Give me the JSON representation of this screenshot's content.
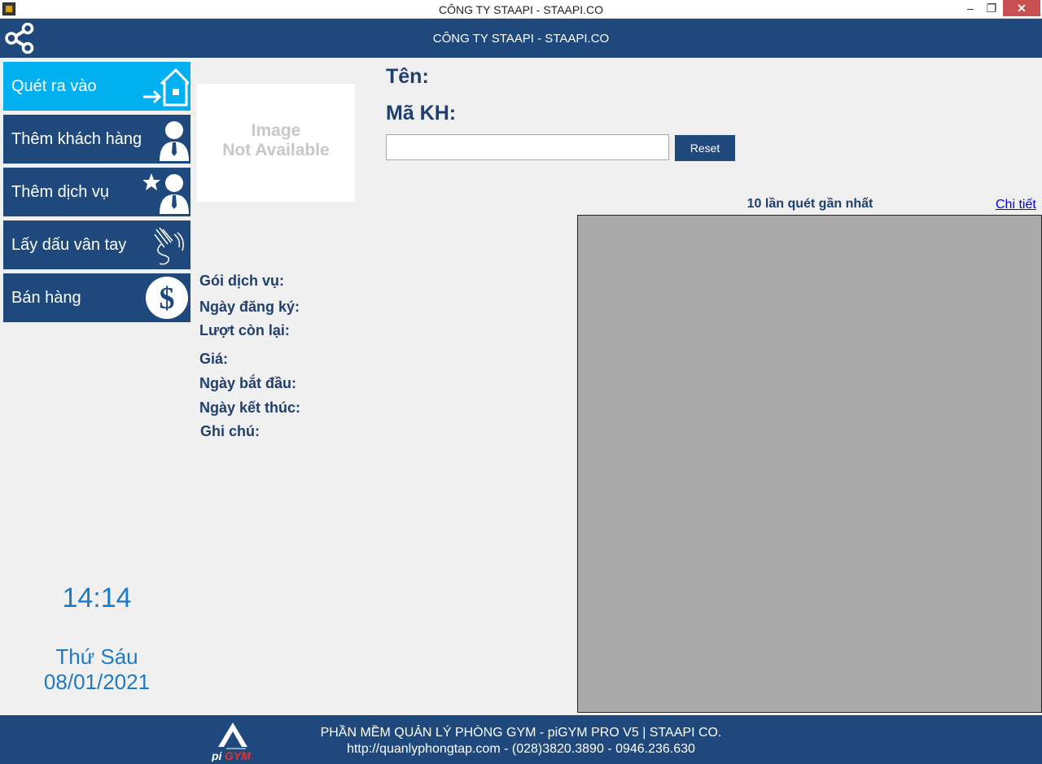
{
  "window": {
    "title": "CÔNG TY STAAPI - STAAPI.CO",
    "min": "–",
    "max": "❐",
    "close": "✕"
  },
  "header": {
    "title": "CÔNG TY STAAPI - STAAPI.CO"
  },
  "menu": [
    {
      "label": "Quét ra vào",
      "icon": "house-enter-icon"
    },
    {
      "label": "Thêm khách hàng",
      "icon": "user-icon"
    },
    {
      "label": "Thêm dịch vụ",
      "icon": "star-user-icon"
    },
    {
      "label": "Lấy dấu vân tay",
      "icon": "fingerprint-hand-icon"
    },
    {
      "label": "Bán hàng",
      "icon": "dollar-icon"
    }
  ],
  "photo": {
    "line1": "Image",
    "line2": "Not Available"
  },
  "customer": {
    "name_label": "Tên:",
    "code_label": "Mã KH:",
    "input_value": "",
    "reset_label": "Reset"
  },
  "info": {
    "package": "Gói dịch vụ:",
    "registered": "Ngày đăng ký:",
    "remaining": "Lượt còn lại:",
    "price": "Giá:",
    "start": "Ngày bắt đầu:",
    "end": "Ngày kết thúc:",
    "note": "Ghi chú:"
  },
  "clock": {
    "time": "14:14",
    "weekday": "Thứ Sáu",
    "date": "08/01/2021"
  },
  "recent": {
    "title": "10 lần quét gần nhất",
    "link": "Chi tiết"
  },
  "footer": {
    "line1": "PHẦN MỀM QUẢN LÝ PHÒNG GYM - piGYM PRO V5 | STAAPI CO.",
    "line2": "http://quanlyphongtap.com - (028)3820.3890 - 0946.236.630",
    "logo_text_pi": "pi",
    "logo_text_gym": "GYM"
  },
  "colors": {
    "primary": "#1f497d",
    "active": "#00b0f0",
    "clock": "#1f7ac4",
    "panel": "#ababab",
    "logo_accent": "#e8322b"
  }
}
